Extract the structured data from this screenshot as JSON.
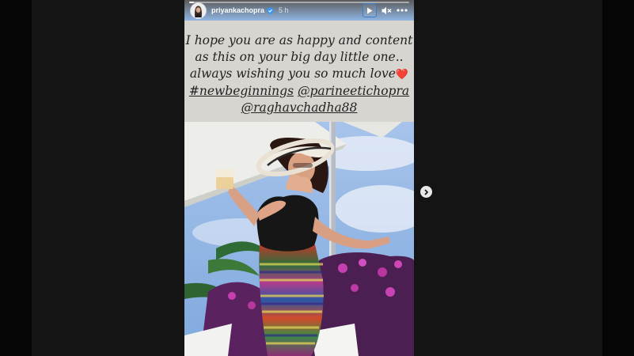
{
  "story": {
    "username": "priyankachopra",
    "timestamp": "5 h",
    "progress": 0.02,
    "caption": {
      "line1": "I hope you are as happy and content",
      "line2": "as this on your big day little one..",
      "line3": "always wishing you so much love",
      "heart": "❤️",
      "hashtag": "#newbeginnings",
      "mention1": "@parineetichopra",
      "mention2": "@raghavchadha88"
    }
  },
  "icons": {
    "verified": "verified-badge-icon",
    "play": "play-icon",
    "mute": "speaker-muted-icon",
    "more": "more-options-icon",
    "next": "chevron-right-icon"
  },
  "colors": {
    "caption_bg": "#d7d5cf",
    "verified": "#3897f0",
    "focus_ring": "#3b7bd4"
  }
}
